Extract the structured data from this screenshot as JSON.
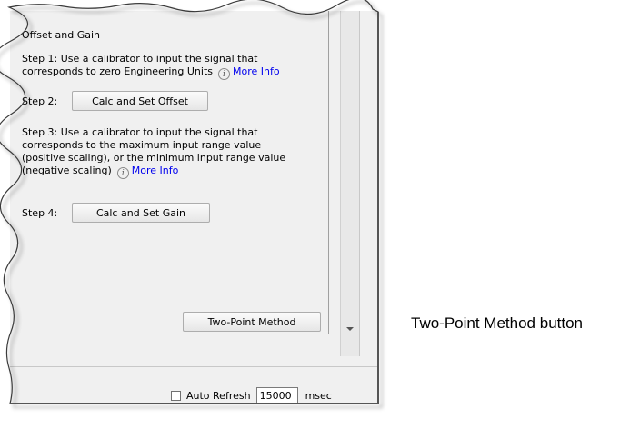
{
  "section": {
    "header": "Offset and Gain"
  },
  "steps": {
    "step1_line1": "Step 1: Use a calibrator to input the signal that",
    "step1_line2": "corresponds to zero Engineering Units",
    "step2_label": "Step 2:",
    "step2_button": "Calc and Set Offset",
    "step3_line1": "Step 3: Use a calibrator to input the signal that",
    "step3_line2": "corresponds to the maximum input range value",
    "step3_line3": "(positive scaling), or the minimum input range value",
    "step3_line4": "(negative scaling)",
    "step4_label": "Step 4:",
    "step4_button": "Calc and Set Gain",
    "more_info": "More Info",
    "info_glyph": "i"
  },
  "method_button": "Two-Point Method",
  "footer": {
    "auto_refresh_label": "Auto Refresh",
    "refresh_value": "15000",
    "refresh_unit": "msec",
    "auto_refresh_checked": false
  },
  "callout": {
    "label": "Two-Point Method button"
  }
}
